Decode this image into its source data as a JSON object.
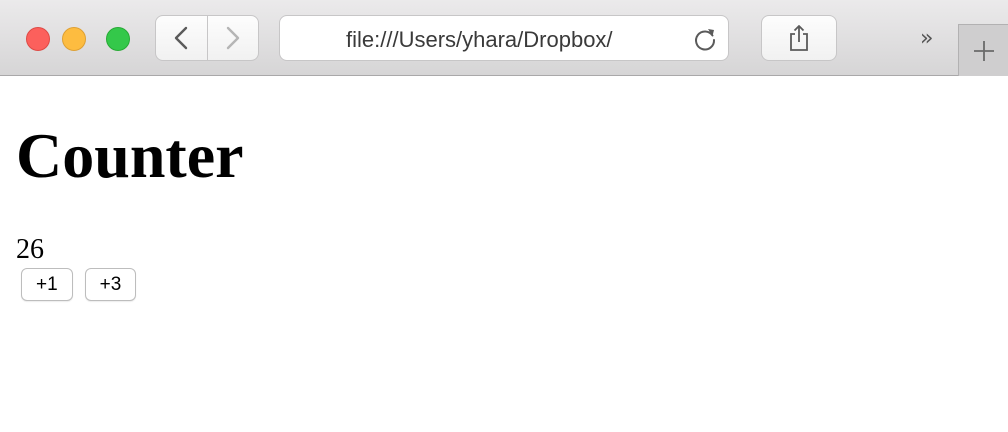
{
  "browser": {
    "url": "file:///Users/yhara/Dropbox/",
    "overflow_glyph": "»",
    "icons": [
      "close-dot",
      "minimize-dot",
      "maximize-dot",
      "back-arrow-icon",
      "forward-arrow-icon",
      "reload-icon",
      "share-icon",
      "plus-icon"
    ]
  },
  "page": {
    "heading": "Counter",
    "count": "26",
    "buttons": {
      "plus_one": "+1",
      "plus_three": "+3"
    }
  }
}
